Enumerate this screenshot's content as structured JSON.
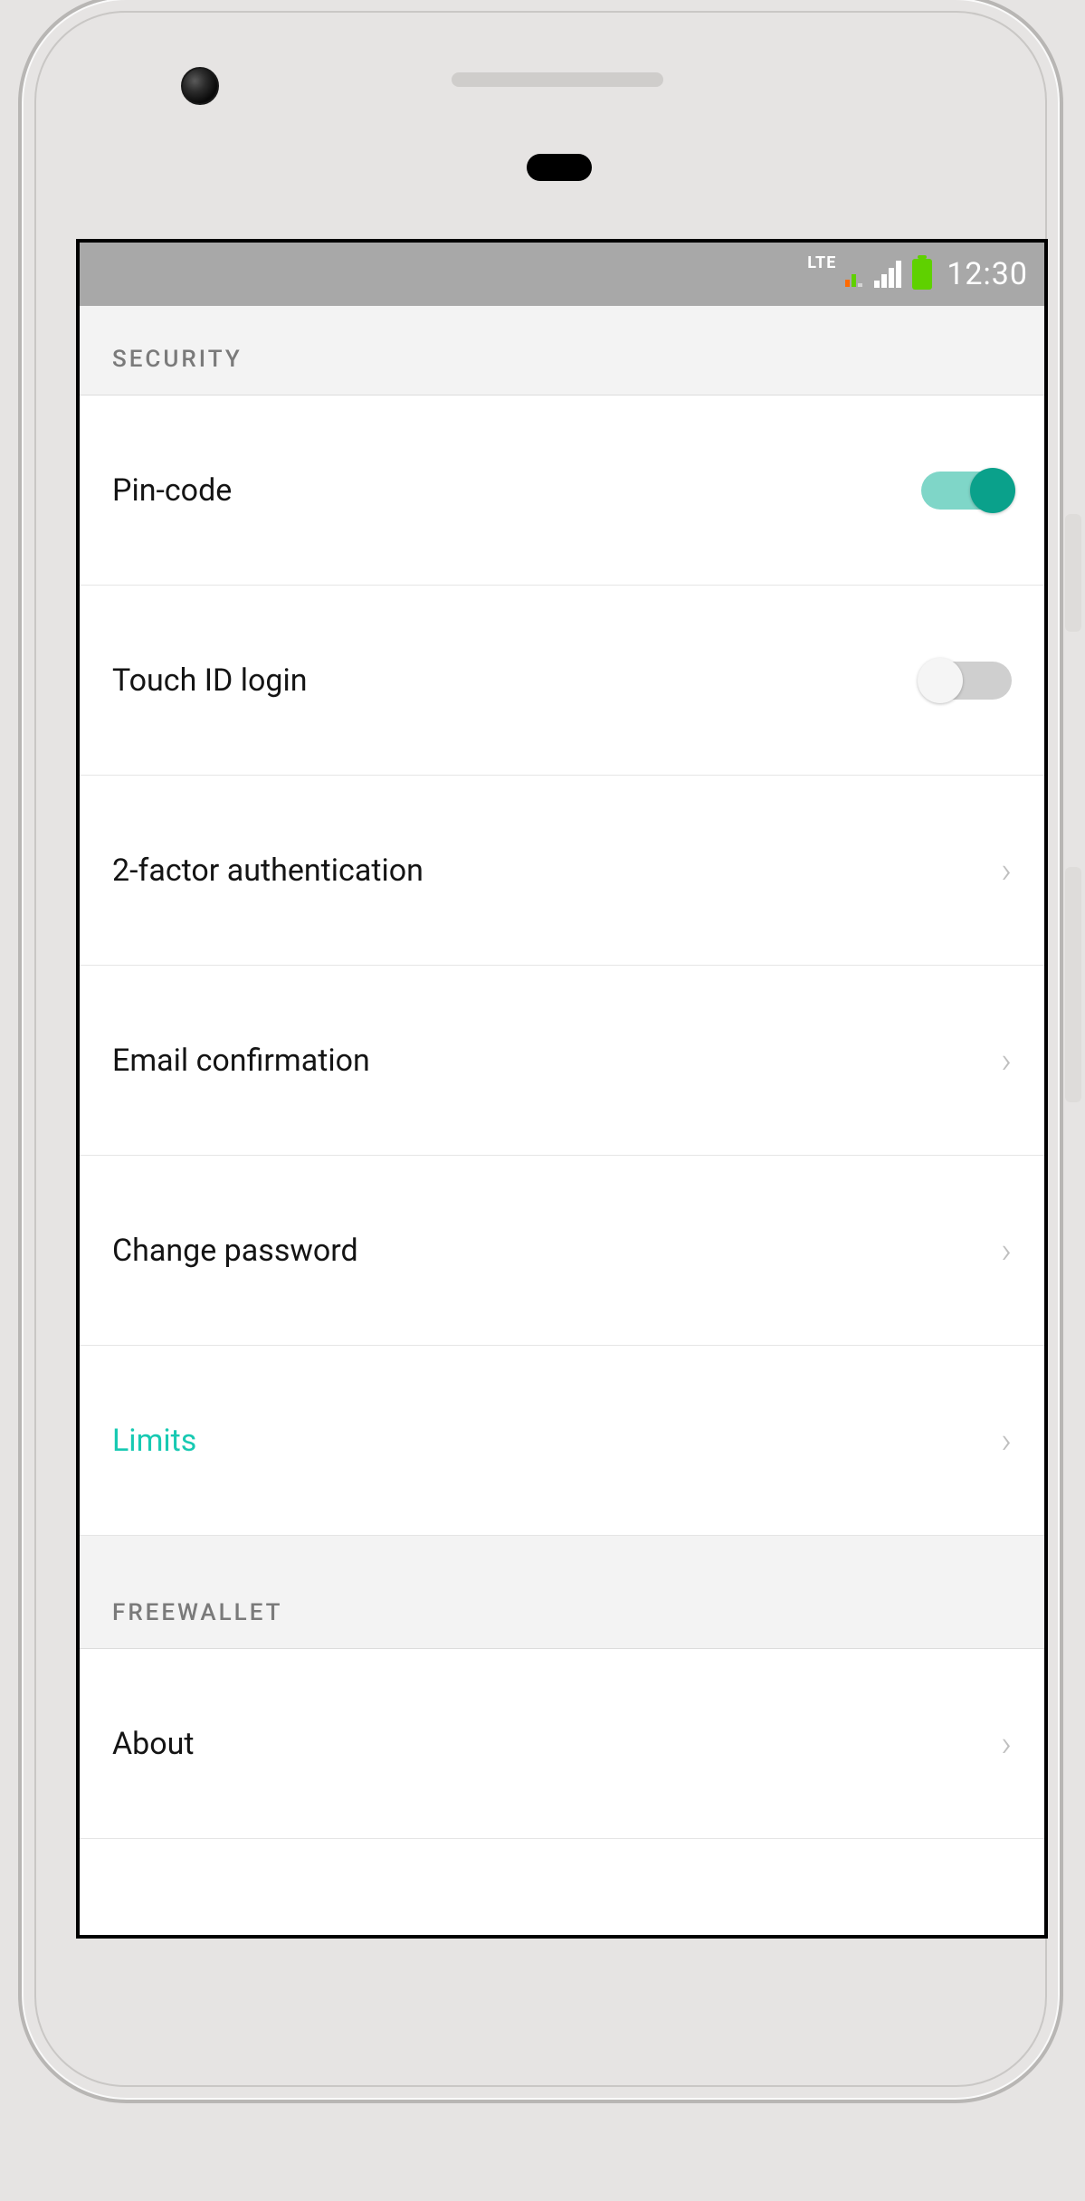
{
  "statusBar": {
    "network": "LTE",
    "time": "12:30"
  },
  "sections": {
    "security": {
      "header": "SECURITY",
      "pinCode": {
        "label": "Pin-code",
        "on": true
      },
      "touchId": {
        "label": "Touch ID login",
        "on": false
      },
      "twoFactor": {
        "label": "2-factor authentication"
      },
      "emailConfirm": {
        "label": "Email confirmation"
      },
      "changePassword": {
        "label": "Change password"
      },
      "limits": {
        "label": "Limits"
      }
    },
    "freewallet": {
      "header": "FREEWALLET",
      "about": {
        "label": "About"
      }
    }
  },
  "colors": {
    "accent": "#17c9b2"
  }
}
